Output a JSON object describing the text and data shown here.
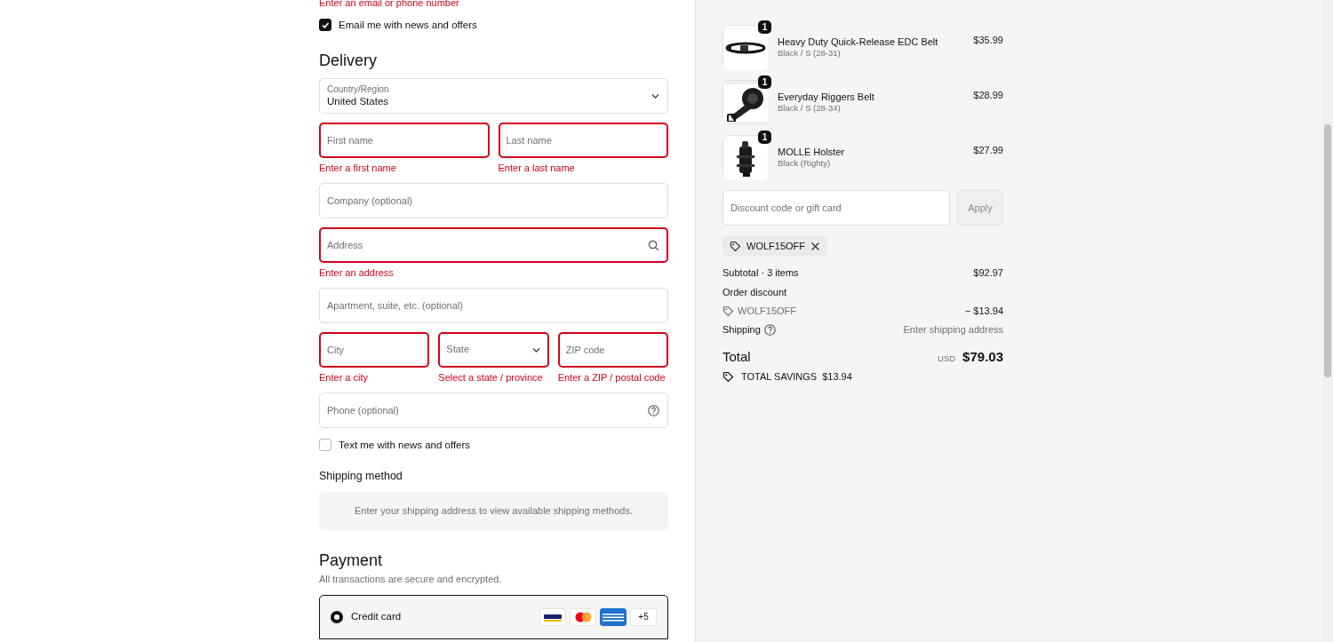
{
  "contact": {
    "error": "Enter an email or phone number",
    "opt_in": {
      "label": "Email me with news and offers",
      "checked": true
    }
  },
  "delivery": {
    "title": "Delivery",
    "rows": [
      [
        {
          "kind": "select",
          "label": "Country/Region",
          "value": "United States",
          "invalid": false
        }
      ],
      [
        {
          "kind": "text",
          "placeholder": "First name",
          "invalid": true,
          "error": "Enter a first name"
        },
        {
          "kind": "text",
          "placeholder": "Last name",
          "invalid": true,
          "error": "Enter a last name"
        }
      ],
      [
        {
          "kind": "text",
          "placeholder": "Company (optional)",
          "invalid": false
        }
      ],
      [
        {
          "kind": "search",
          "placeholder": "Address",
          "invalid": true,
          "error": "Enter an address"
        }
      ],
      [
        {
          "kind": "text",
          "placeholder": "Apartment, suite, etc. (optional)",
          "invalid": false
        }
      ],
      [
        {
          "kind": "text",
          "placeholder": "City",
          "invalid": true,
          "error": "Enter a city"
        },
        {
          "kind": "select",
          "placeholder": "State",
          "invalid": true,
          "error": "Select a state / province"
        },
        {
          "kind": "text",
          "placeholder": "ZIP code",
          "invalid": true,
          "error": "Enter a ZIP / postal code"
        }
      ],
      [
        {
          "kind": "help",
          "placeholder": "Phone (optional)",
          "invalid": false
        }
      ]
    ],
    "sms_opt_in": {
      "label": "Text me with news and offers",
      "checked": false
    }
  },
  "shipping_method": {
    "title": "Shipping method",
    "message": "Enter your shipping address to view available shipping methods."
  },
  "payment": {
    "title": "Payment",
    "subtitle": "All transactions are secure and encrypted.",
    "options": [
      {
        "label": "Credit card",
        "selected": true,
        "more_cards": "+5"
      }
    ]
  },
  "summary": {
    "items": [
      {
        "name": "Heavy Duty Quick-Release EDC Belt",
        "variant": "Black / S (28-31)",
        "price": "$35.99",
        "quantity": "1",
        "kind": "belt"
      },
      {
        "name": "Everyday Riggers Belt",
        "variant": "Black / S (28-34)",
        "price": "$28.99",
        "quantity": "1",
        "kind": "coil"
      },
      {
        "name": "MOLLE Holster",
        "variant": "Black (Righty)",
        "price": "$27.99",
        "quantity": "1",
        "kind": "holster"
      }
    ],
    "discount": {
      "placeholder": "Discount code or gift card",
      "button": "Apply"
    },
    "applied_codes": [
      "WOLF15OFF"
    ],
    "lines": [
      {
        "label": "Subtotal · 3 items",
        "value": "$92.97"
      },
      {
        "label": "Order discount"
      },
      {
        "code": "WOLF15OFF",
        "value": "− $13.94"
      },
      {
        "label": "Shipping",
        "help": true,
        "value": "Enter shipping address",
        "muted": true
      }
    ],
    "total": {
      "label": "Total",
      "currency": "USD",
      "amount": "$79.03"
    },
    "savings": {
      "label": "TOTAL SAVINGS",
      "amount": "$13.94"
    }
  }
}
